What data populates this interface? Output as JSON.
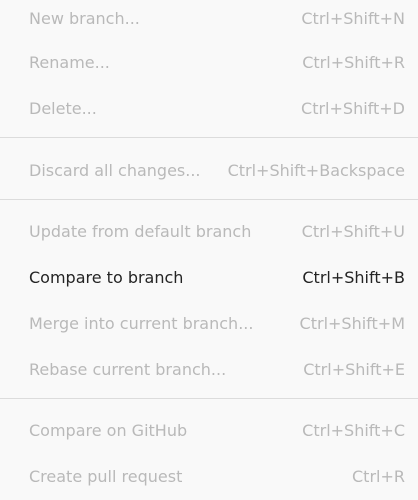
{
  "menu": {
    "items": [
      {
        "label": "New branch...",
        "shortcut": "Ctrl+Shift+N"
      },
      {
        "label": "Rename...",
        "shortcut": "Ctrl+Shift+R"
      },
      {
        "label": "Delete...",
        "shortcut": "Ctrl+Shift+D"
      },
      {
        "label": "Discard all changes...",
        "shortcut": "Ctrl+Shift+Backspace"
      },
      {
        "label": "Update from default branch",
        "shortcut": "Ctrl+Shift+U"
      },
      {
        "label": "Compare to branch",
        "shortcut": "Ctrl+Shift+B"
      },
      {
        "label": "Merge into current branch...",
        "shortcut": "Ctrl+Shift+M"
      },
      {
        "label": "Rebase current branch...",
        "shortcut": "Ctrl+Shift+E"
      },
      {
        "label": "Compare on GitHub",
        "shortcut": "Ctrl+Shift+C"
      },
      {
        "label": "Create pull request",
        "shortcut": "Ctrl+R"
      }
    ]
  },
  "colors": {
    "background": "#f9f9f9",
    "enabled_text": "#242424",
    "disabled_text": "#b9b9b9",
    "separator": "#dcdcdc"
  }
}
